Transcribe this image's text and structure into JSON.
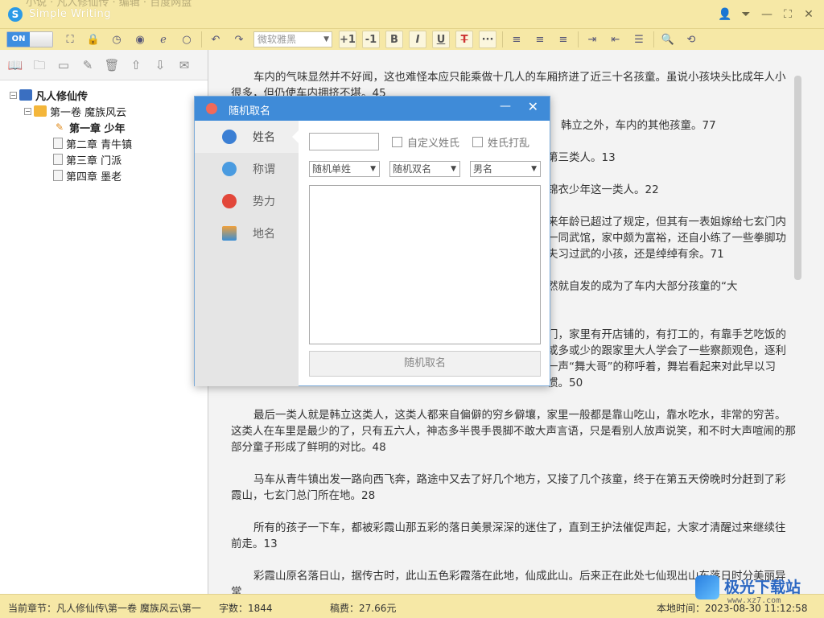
{
  "window": {
    "app_title": "Simple Writing",
    "background_text": "小说 · 凡人修仙传 · 编辑 · 百度网盘"
  },
  "toolbar": {
    "toggle_label": "ON",
    "font_name": "微软雅黑",
    "size_up": "+1",
    "size_down": "-1",
    "bold": "B",
    "italic": "I",
    "underline": "U",
    "strike": "T",
    "more": "···"
  },
  "tree": {
    "root": "凡人修仙传",
    "volume": "第一卷 魔族风云",
    "chapters": [
      "第一章 少年",
      "第二章 青牛镇",
      "第三章 门派",
      "第四章 墨老"
    ]
  },
  "editor": {
    "paragraphs": [
      "车内的气味显然并不好闻，这也难怪本应只能乘做十几人的车厢挤进了近三十名孩童。虽说小孩块头比成年人小很多，但仍使车内拥挤不堪。45",
      "韩立之外，车内的其他孩童。77",
      "第三类人。13",
      "锦衣少年这一类人。22",
      "来年龄已超过了规定，但其有一表姐嫁给七玄门内一同武馆，家中颇为富裕，还自小练了一些拳脚功夫习过武的小孩，还是绰绰有余。71",
      "然就自发的成为了车内大部分孩童的“大",
      "门，家里有开店铺的，有打工的，有靠手艺吃饭的或多或少的跟家里大人学会了一些察颜观色，逐利一声“舞大哥”的称呼着，舞岩看起来对此早以习惯。50",
      "最后一类人就是韩立这类人，这类人都来自偏僻的穷乡僻壤，家里一般都是靠山吃山，靠水吃水，非常的穷苦。这类人在车里是最少的了，只有五六人，神态多半畏手畏脚不敢大声言语，只是看别人放声说笑，和不时大声喧闹的那部分童子形成了鲜明的对比。48",
      "马车从青牛镇出发一路向西飞奔，路途中又去了好几个地方，又接了几个孩童，终于在第五天傍晚时分赶到了彩霞山，七玄门总门所在地。28",
      "所有的孩子一下车，都被彩霞山那五彩的落日美景深深的迷住了，直到王护法催促声起，大家才清醒过来继续往前走。13",
      "彩霞山原名落日山，据传古时，此山五色彩霞落在此地，仙成此山。后来正在此处七仙现出山东落日时分美丽异常"
    ]
  },
  "dialog": {
    "title": "随机取名",
    "sidebar": [
      "姓名",
      "称谓",
      "势力",
      "地名"
    ],
    "custom_surname": "自定义姓氏",
    "shuffle_surname": "姓氏打乱",
    "surname_select": "随机单姓",
    "given_select": "随机双名",
    "gender_select": "男名",
    "generate_button": "随机取名"
  },
  "status": {
    "chapter": "当前章节：凡人修仙传\\第一卷 魔族风云\\第一",
    "words": "字数：1844",
    "fee": "稿费：27.66元",
    "time": "本地时间：2023-08-30 11:12:58"
  },
  "watermark": {
    "text": "极光下载站",
    "url": "www.xz7.com"
  }
}
